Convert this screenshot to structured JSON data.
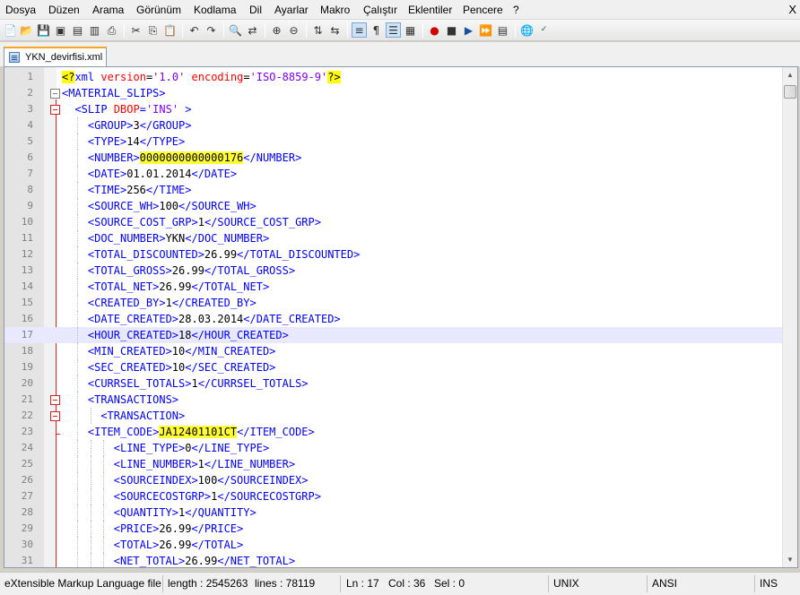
{
  "menu": [
    "Dosya",
    "Düzen",
    "Arama",
    "Görünüm",
    "Kodlama",
    "Dil",
    "Ayarlar",
    "Makro",
    "Çalıştır",
    "Eklentiler",
    "Pencere",
    "?"
  ],
  "menu_close": "X",
  "toolbar_icons": [
    "new-file-icon",
    "open-file-icon",
    "save-icon",
    "save-all-icon",
    "close-icon",
    "close-all-icon",
    "print-icon",
    "cut-icon",
    "copy-icon",
    "paste-icon",
    "undo-icon",
    "redo-icon",
    "find-icon",
    "replace-icon",
    "zoom-in-icon",
    "zoom-out-icon",
    "sync-vertical-icon",
    "sync-horizontal-icon",
    "word-wrap-icon",
    "show-all-chars-icon",
    "indent-guide-icon",
    "document-map-icon",
    "record-macro-icon",
    "stop-macro-icon",
    "play-macro-icon",
    "run-macro-multiple-icon",
    "save-macro-icon",
    "launch-browser-icon",
    "spell-check-icon"
  ],
  "tab": {
    "label": "YKN_devirfisi.xml",
    "icon": "xml-file-icon"
  },
  "lines": [
    {
      "n": "1",
      "indent": 0,
      "parts": [
        [
          "pi",
          "<?"
        ],
        [
          "tag",
          "xml "
        ],
        [
          "attr",
          "version"
        ],
        [
          "text",
          "="
        ],
        [
          "val",
          "'1.0'"
        ],
        [
          "text",
          " "
        ],
        [
          "attr",
          "encoding"
        ],
        [
          "text",
          "="
        ],
        [
          "val",
          "'ISO-8859-9'"
        ],
        [
          "pi",
          "?>"
        ]
      ]
    },
    {
      "n": "2",
      "indent": 0,
      "parts": [
        [
          "tag",
          "<MATERIAL_SLIPS>"
        ]
      ]
    },
    {
      "n": "3",
      "indent": 2,
      "parts": [
        [
          "tag",
          "<SLIP "
        ],
        [
          "attr",
          "DBOP"
        ],
        [
          "tag",
          "="
        ],
        [
          "val",
          "'INS'"
        ],
        [
          "tag",
          " >"
        ]
      ]
    },
    {
      "n": "4",
      "indent": 4,
      "parts": [
        [
          "tag",
          "<GROUP>"
        ],
        [
          "text",
          "3"
        ],
        [
          "tag",
          "</GROUP>"
        ]
      ]
    },
    {
      "n": "5",
      "indent": 4,
      "parts": [
        [
          "tag",
          "<TYPE>"
        ],
        [
          "text",
          "14"
        ],
        [
          "tag",
          "</TYPE>"
        ]
      ]
    },
    {
      "n": "6",
      "indent": 4,
      "parts": [
        [
          "tag",
          "<NUMBER>"
        ],
        [
          "hl",
          "0000000000000176"
        ],
        [
          "tag",
          "</NUMBER>"
        ]
      ]
    },
    {
      "n": "7",
      "indent": 4,
      "parts": [
        [
          "tag",
          "<DATE>"
        ],
        [
          "text",
          "01.01.2014"
        ],
        [
          "tag",
          "</DATE>"
        ]
      ]
    },
    {
      "n": "8",
      "indent": 4,
      "parts": [
        [
          "tag",
          "<TIME>"
        ],
        [
          "text",
          "256"
        ],
        [
          "tag",
          "</TIME>"
        ]
      ]
    },
    {
      "n": "9",
      "indent": 4,
      "parts": [
        [
          "tag",
          "<SOURCE_WH>"
        ],
        [
          "text",
          "100"
        ],
        [
          "tag",
          "</SOURCE_WH>"
        ]
      ]
    },
    {
      "n": "10",
      "indent": 4,
      "parts": [
        [
          "tag",
          "<SOURCE_COST_GRP>"
        ],
        [
          "text",
          "1"
        ],
        [
          "tag",
          "</SOURCE_COST_GRP>"
        ]
      ]
    },
    {
      "n": "11",
      "indent": 4,
      "parts": [
        [
          "tag",
          "<DOC_NUMBER>"
        ],
        [
          "text",
          "YKN"
        ],
        [
          "tag",
          "</DOC_NUMBER>"
        ]
      ]
    },
    {
      "n": "12",
      "indent": 4,
      "parts": [
        [
          "tag",
          "<TOTAL_DISCOUNTED>"
        ],
        [
          "text",
          "26.99"
        ],
        [
          "tag",
          "</TOTAL_DISCOUNTED>"
        ]
      ]
    },
    {
      "n": "13",
      "indent": 4,
      "parts": [
        [
          "tag",
          "<TOTAL_GROSS>"
        ],
        [
          "text",
          "26.99"
        ],
        [
          "tag",
          "</TOTAL_GROSS>"
        ]
      ]
    },
    {
      "n": "14",
      "indent": 4,
      "parts": [
        [
          "tag",
          "<TOTAL_NET>"
        ],
        [
          "text",
          "26.99"
        ],
        [
          "tag",
          "</TOTAL_NET>"
        ]
      ]
    },
    {
      "n": "15",
      "indent": 4,
      "parts": [
        [
          "tag",
          "<CREATED_BY>"
        ],
        [
          "text",
          "1"
        ],
        [
          "tag",
          "</CREATED_BY>"
        ]
      ]
    },
    {
      "n": "16",
      "indent": 4,
      "parts": [
        [
          "tag",
          "<DATE_CREATED>"
        ],
        [
          "text",
          "28.03.2014"
        ],
        [
          "tag",
          "</DATE_CREATED>"
        ]
      ]
    },
    {
      "n": "17",
      "indent": 4,
      "current": true,
      "parts": [
        [
          "tag",
          "<HOUR_CREATED>"
        ],
        [
          "text",
          "18"
        ],
        [
          "tag",
          "</HOUR_CREATED>"
        ]
      ]
    },
    {
      "n": "18",
      "indent": 4,
      "parts": [
        [
          "tag",
          "<MIN_CREATED>"
        ],
        [
          "text",
          "10"
        ],
        [
          "tag",
          "</MIN_CREATED>"
        ]
      ]
    },
    {
      "n": "19",
      "indent": 4,
      "parts": [
        [
          "tag",
          "<SEC_CREATED>"
        ],
        [
          "text",
          "10"
        ],
        [
          "tag",
          "</SEC_CREATED>"
        ]
      ]
    },
    {
      "n": "20",
      "indent": 4,
      "parts": [
        [
          "tag",
          "<CURRSEL_TOTALS>"
        ],
        [
          "text",
          "1"
        ],
        [
          "tag",
          "</CURRSEL_TOTALS>"
        ]
      ]
    },
    {
      "n": "21",
      "indent": 4,
      "parts": [
        [
          "tag",
          "<TRANSACTIONS>"
        ]
      ]
    },
    {
      "n": "22",
      "indent": 6,
      "parts": [
        [
          "tag",
          "<TRANSACTION>"
        ]
      ]
    },
    {
      "n": "23",
      "indent": 4,
      "parts": [
        [
          "tag",
          "<ITEM_CODE>"
        ],
        [
          "hl",
          "JA12401101CT"
        ],
        [
          "tag",
          "</ITEM_CODE>"
        ]
      ]
    },
    {
      "n": "24",
      "indent": 8,
      "parts": [
        [
          "tag",
          "<LINE_TYPE>"
        ],
        [
          "text",
          "0"
        ],
        [
          "tag",
          "</LINE_TYPE>"
        ]
      ]
    },
    {
      "n": "25",
      "indent": 8,
      "parts": [
        [
          "tag",
          "<LINE_NUMBER>"
        ],
        [
          "text",
          "1"
        ],
        [
          "tag",
          "</LINE_NUMBER>"
        ]
      ]
    },
    {
      "n": "26",
      "indent": 8,
      "parts": [
        [
          "tag",
          "<SOURCEINDEX>"
        ],
        [
          "text",
          "100"
        ],
        [
          "tag",
          "</SOURCEINDEX>"
        ]
      ]
    },
    {
      "n": "27",
      "indent": 8,
      "parts": [
        [
          "tag",
          "<SOURCECOSTGRP>"
        ],
        [
          "text",
          "1"
        ],
        [
          "tag",
          "</SOURCECOSTGRP>"
        ]
      ]
    },
    {
      "n": "28",
      "indent": 8,
      "parts": [
        [
          "tag",
          "<QUANTITY>"
        ],
        [
          "text",
          "1"
        ],
        [
          "tag",
          "</QUANTITY>"
        ]
      ]
    },
    {
      "n": "29",
      "indent": 8,
      "parts": [
        [
          "tag",
          "<PRICE>"
        ],
        [
          "text",
          "26.99"
        ],
        [
          "tag",
          "</PRICE>"
        ]
      ]
    },
    {
      "n": "30",
      "indent": 8,
      "parts": [
        [
          "tag",
          "<TOTAL>"
        ],
        [
          "text",
          "26.99"
        ],
        [
          "tag",
          "</TOTAL>"
        ]
      ]
    },
    {
      "n": "31",
      "indent": 8,
      "parts": [
        [
          "tag",
          "<NET_TOTAL>"
        ],
        [
          "text",
          "26.99"
        ],
        [
          "tag",
          "</NET_TOTAL>"
        ]
      ]
    }
  ],
  "status": {
    "file_type": "eXtensible Markup Language file",
    "length": "length : 2545263",
    "lines": "lines : 78119",
    "ln": "Ln : 17",
    "col": "Col : 36",
    "sel": "Sel : 0",
    "eol": "UNIX",
    "encoding": "ANSI",
    "mode": "INS"
  },
  "colors": {
    "tag": "#0000ff",
    "attr": "#ff0000",
    "value": "#8000ff",
    "highlight": "#ffff33",
    "current_line": "#e8e8ff"
  }
}
